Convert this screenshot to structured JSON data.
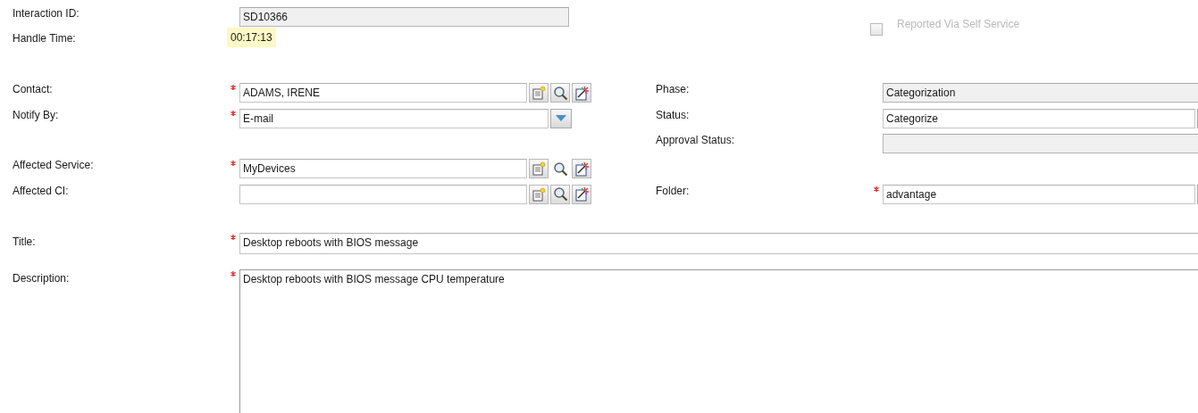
{
  "header": {
    "interaction_id": {
      "label": "Interaction ID:",
      "value": "SD10366"
    },
    "handle_time": {
      "label": "Handle Time:",
      "value": "00:17:13"
    },
    "self_service": {
      "label": "Reported Via Self Service",
      "checked": false,
      "disabled": true
    }
  },
  "sections": [
    {
      "rows": [
        {
          "left": {
            "label": "Contact:",
            "kind": "lookup",
            "required": true,
            "value": "ADAMS, IRENE",
            "icons": [
              {
                "kind": "detail",
                "framed": true
              },
              {
                "kind": "search",
                "framed": true
              },
              {
                "kind": "wizard",
                "framed": true
              }
            ]
          },
          "right": {
            "label": "Phase:",
            "kind": "readonly",
            "required": false,
            "value": "Categorization"
          }
        },
        {
          "left": {
            "label": "Notify By:",
            "kind": "dropdown",
            "required": true,
            "value": "E-mail"
          },
          "right": {
            "label": "Status:",
            "kind": "dropdown",
            "required": false,
            "value": "Categorize"
          }
        },
        {
          "right": {
            "label": "Approval Status:",
            "kind": "readonly",
            "required": false
          }
        }
      ]
    },
    {
      "rows": [
        {
          "left": {
            "label": "Affected Service:",
            "kind": "lookup",
            "required": true,
            "value": "MyDevices",
            "icons": [
              {
                "kind": "detail",
                "framed": true
              },
              {
                "kind": "search",
                "framed": false
              },
              {
                "kind": "wizard",
                "framed": true
              }
            ]
          }
        },
        {
          "left": {
            "label": "Affected CI:",
            "kind": "lookup",
            "required": false,
            "icons": [
              {
                "kind": "detail",
                "framed": true
              },
              {
                "kind": "search",
                "framed": true
              },
              {
                "kind": "wizard",
                "framed": true
              }
            ]
          },
          "right": {
            "label": "Folder:",
            "kind": "dropdown",
            "required": true,
            "value": "advantage"
          }
        }
      ]
    }
  ],
  "title": {
    "label": "Title:",
    "required": true,
    "value": "Desktop reboots with BIOS message"
  },
  "description": {
    "label": "Description:",
    "required": true,
    "value": "Desktop reboots with BIOS message CPU temperature"
  }
}
